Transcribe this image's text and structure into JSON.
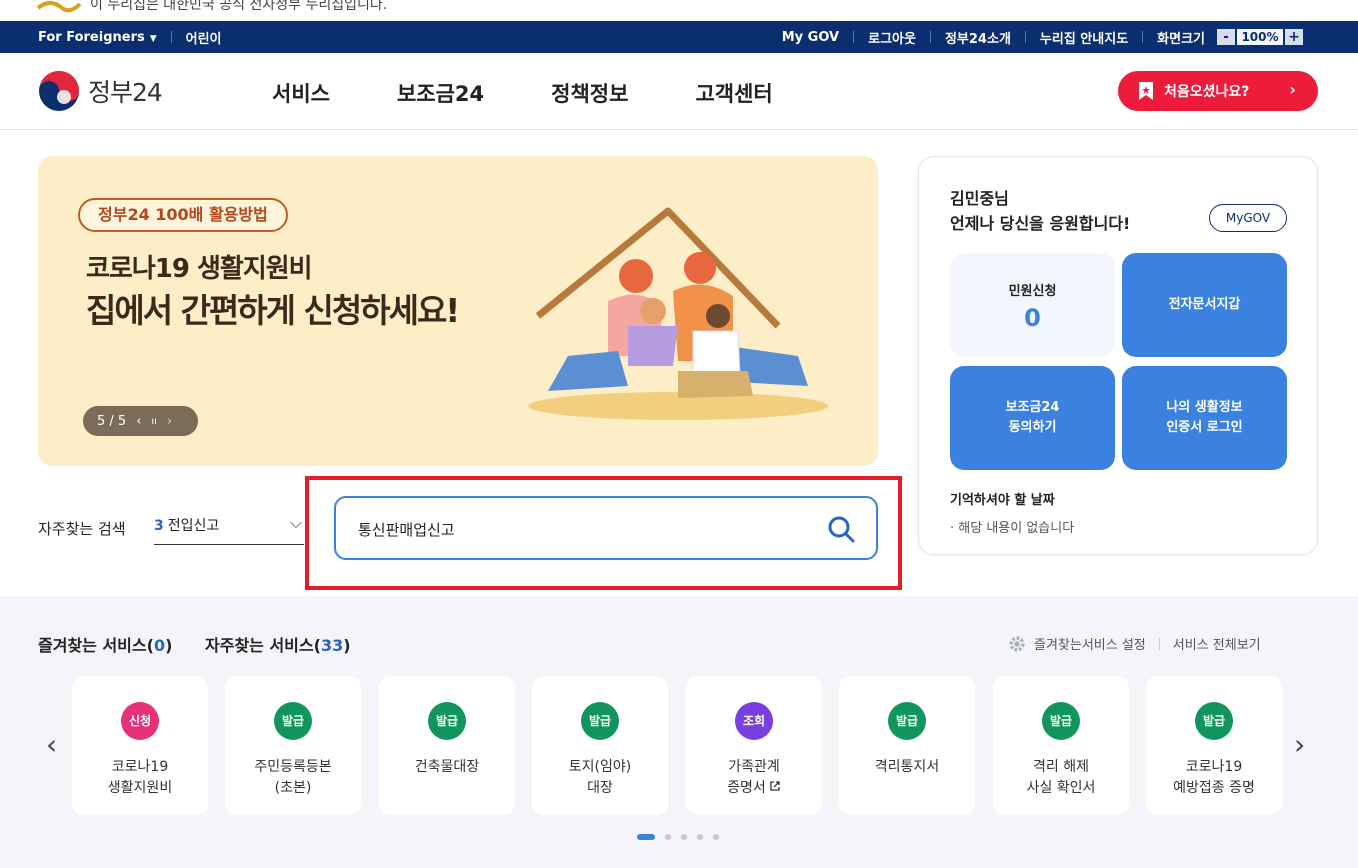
{
  "notice": {
    "text": "이 누리집은 대한민국 공식 전자정부 누리집입니다."
  },
  "util_bar": {
    "left": [
      "For Foreigners",
      "어린이"
    ],
    "right": [
      "My GOV",
      "로그아웃",
      "정부24소개",
      "누리집 안내지도",
      "화면크기"
    ],
    "zoom_minus": "-",
    "zoom_value": "100%",
    "zoom_plus": "+"
  },
  "header": {
    "logo_text": "정부24",
    "nav": [
      "서비스",
      "보조금24",
      "정책정보",
      "고객센터"
    ],
    "first_visit_label": "처음오셨나요?"
  },
  "banner": {
    "tag": "정부24 100배 활용방법",
    "line1": "코로나19 생활지원비",
    "line2": "집에서 간편하게 신청하세요!",
    "pager_text": "5 / 5",
    "prev_glyph": "‹",
    "pause_glyph": "ıı",
    "next_glyph": "›"
  },
  "user_panel": {
    "greeting_name": "김민중님",
    "greeting_msg": "언제나 당신을 응원합니다!",
    "mygov_label": "MyGOV",
    "tiles": [
      {
        "label": "민원신청",
        "count": "0"
      },
      {
        "label": "전자문서지갑"
      },
      {
        "line1": "보조금24",
        "line2": "동의하기"
      },
      {
        "line1": "나의 생활정보",
        "line2": "인증서 로그인"
      }
    ],
    "remember_title": "기억하셔야 할 날짜",
    "remember_none": "· 해당 내용이 없습니다"
  },
  "search": {
    "label": "자주찾는 검색",
    "select_num": "3",
    "select_text": "전입신고",
    "value": "통신판매업신고"
  },
  "services": {
    "fav_title": "즐겨찾는 서비스",
    "fav_count": "0",
    "freq_title": "자주찾는 서비스",
    "freq_count": "33",
    "settings_label": "즐겨찾는서비스 설정",
    "view_all_label": "서비스 전체보기",
    "cards": [
      {
        "badge": "신청",
        "color": "#e6307a",
        "l1": "코로나19",
        "l2": "생활지원비"
      },
      {
        "badge": "발급",
        "color": "#11955c",
        "l1": "주민등록등본",
        "l2": "(초본)"
      },
      {
        "badge": "발급",
        "color": "#11955c",
        "l1": "건축물대장",
        "l2": ""
      },
      {
        "badge": "발급",
        "color": "#11955c",
        "l1": "토지(임야)",
        "l2": "대장"
      },
      {
        "badge": "조회",
        "color": "#7a3fe0",
        "l1": "가족관계",
        "l2": "증명서"
      },
      {
        "badge": "발급",
        "color": "#11955c",
        "l1": "격리통지서",
        "l2": ""
      },
      {
        "badge": "발급",
        "color": "#11955c",
        "l1": "격리 해제",
        "l2": "사실 확인서"
      },
      {
        "badge": "발급",
        "color": "#11955c",
        "l1": "코로나19",
        "l2": "예방접종 증명"
      }
    ]
  }
}
